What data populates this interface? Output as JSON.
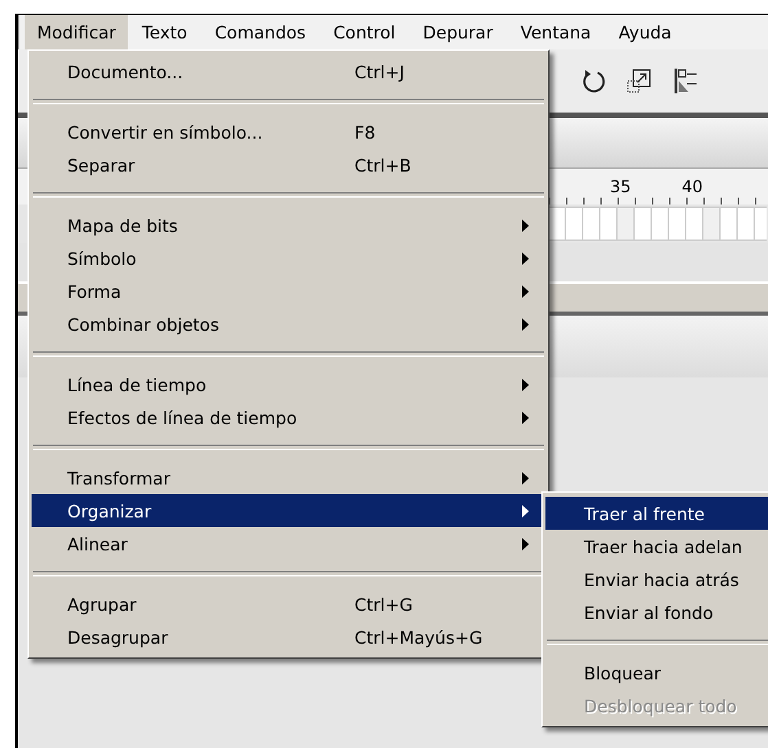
{
  "menu_bar": [
    {
      "label": "Modificar",
      "selected": true
    },
    {
      "label": "Texto",
      "selected": false
    },
    {
      "label": "Comandos",
      "selected": false
    },
    {
      "label": "Control",
      "selected": false
    },
    {
      "label": "Depurar",
      "selected": false
    },
    {
      "label": "Ventana",
      "selected": false
    },
    {
      "label": "Ayuda",
      "selected": false
    }
  ],
  "menu": {
    "items": [
      {
        "kind": "item",
        "label": "Documento...",
        "shortcut": "Ctrl+J",
        "selected": false
      },
      {
        "kind": "separator"
      },
      {
        "kind": "item",
        "label": "Convertir en símbolo...",
        "shortcut": "F8",
        "selected": false
      },
      {
        "kind": "item",
        "label": "Separar",
        "shortcut": "Ctrl+B",
        "selected": false
      },
      {
        "kind": "separator"
      },
      {
        "kind": "submenu",
        "label": "Mapa de bits",
        "selected": false
      },
      {
        "kind": "submenu",
        "label": "Símbolo",
        "selected": false
      },
      {
        "kind": "submenu",
        "label": "Forma",
        "selected": false
      },
      {
        "kind": "submenu",
        "label": "Combinar objetos",
        "selected": false
      },
      {
        "kind": "separator"
      },
      {
        "kind": "submenu",
        "label": "Línea de tiempo",
        "selected": false
      },
      {
        "kind": "submenu",
        "label": "Efectos de línea de tiempo",
        "selected": false
      },
      {
        "kind": "separator"
      },
      {
        "kind": "submenu",
        "label": "Transformar",
        "selected": false
      },
      {
        "kind": "submenu",
        "label": "Organizar",
        "selected": true
      },
      {
        "kind": "submenu",
        "label": "Alinear",
        "selected": false
      },
      {
        "kind": "separator"
      },
      {
        "kind": "item",
        "label": "Agrupar",
        "shortcut": "Ctrl+G",
        "selected": false
      },
      {
        "kind": "item",
        "label": "Desagrupar",
        "shortcut": "Ctrl+Mayús+G",
        "selected": false
      }
    ]
  },
  "submenu": {
    "items": [
      {
        "kind": "item",
        "label": "Traer al frente",
        "selected": true,
        "disabled": false
      },
      {
        "kind": "item",
        "label": "Traer hacia adelan",
        "selected": false,
        "disabled": false
      },
      {
        "kind": "item",
        "label": "Enviar hacia atrás",
        "selected": false,
        "disabled": false
      },
      {
        "kind": "item",
        "label": "Enviar al fondo",
        "selected": false,
        "disabled": false
      },
      {
        "kind": "separator"
      },
      {
        "kind": "item",
        "label": "Bloquear",
        "selected": false,
        "disabled": false
      },
      {
        "kind": "item",
        "label": "Desbloquear todo",
        "selected": false,
        "disabled": true
      }
    ]
  },
  "timeline": {
    "ruler_labels": [
      "35",
      "40"
    ]
  }
}
